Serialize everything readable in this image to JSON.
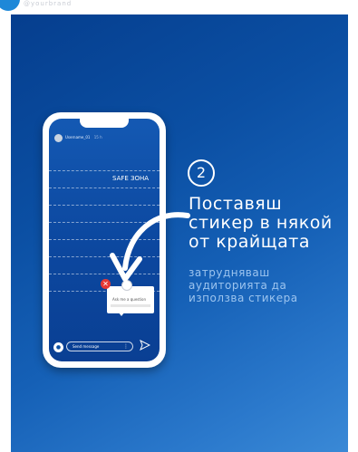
{
  "top": {
    "title": "@yourbrand"
  },
  "phone": {
    "username": "Username_01",
    "time": "15 h",
    "safe_zone_label": "SAFE ЗОНА",
    "sticker": {
      "prompt": "Ask me a question"
    },
    "message_placeholder": "Send message"
  },
  "step": {
    "number": "2",
    "heading_lines": [
      "Поставяш",
      "стикер в някой",
      "от крайщата"
    ],
    "sub_lines": [
      "затрудняваш",
      "аудиторията да",
      "използва стикера"
    ]
  },
  "colors": {
    "accent": "#1e88d8",
    "panel_top": "#053e8e",
    "panel_bottom": "#3a89d6",
    "close_red": "#e53935"
  },
  "icons": [
    "camera-icon",
    "send-icon",
    "close-icon",
    "arrow-icon"
  ]
}
